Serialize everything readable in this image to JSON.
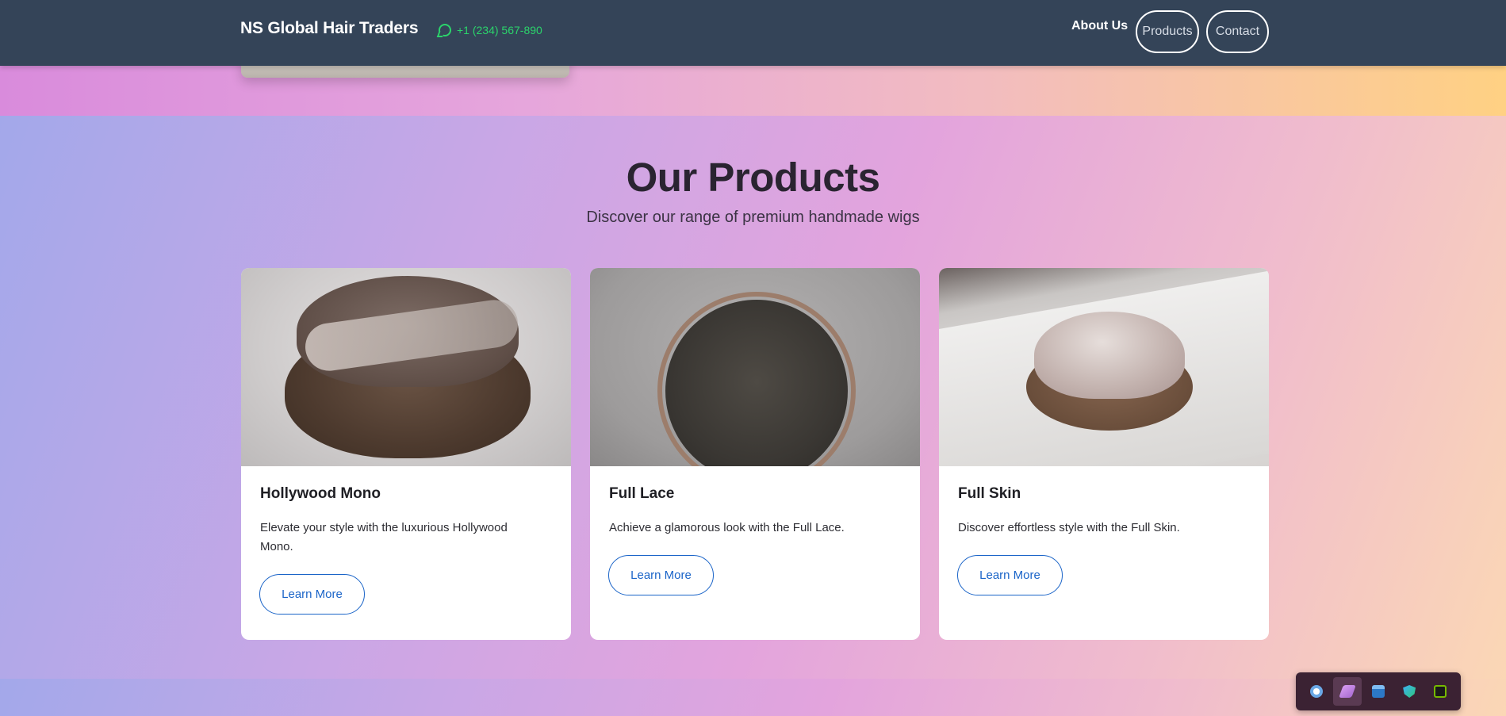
{
  "navbar": {
    "brand": "NS Global Hair Traders",
    "phone": "+1 (234) 567-890",
    "links": [
      "About Us",
      "Products",
      "Contact"
    ]
  },
  "products_section": {
    "title": "Our Products",
    "subtitle": "Discover our range of premium handmade wigs",
    "cards": [
      {
        "title": "Hollywood Mono",
        "description": "Elevate your style with the luxurious Hollywood Mono.",
        "button": "Learn More"
      },
      {
        "title": "Full Lace",
        "description": "Achieve a glamorous look with the Full Lace.",
        "button": "Learn More"
      },
      {
        "title": "Full Skin",
        "description": "Discover effortless style with the Full Skin.",
        "button": "Learn More"
      }
    ]
  },
  "tray": {
    "icons": [
      "steam-icon",
      "feather-icon",
      "window-icon",
      "shield-icon",
      "nvidia-icon"
    ],
    "active_index": 1
  },
  "colors": {
    "navbar_bg": "#344458",
    "phone_green": "#2bd46b",
    "button_blue": "#1a64c8"
  }
}
